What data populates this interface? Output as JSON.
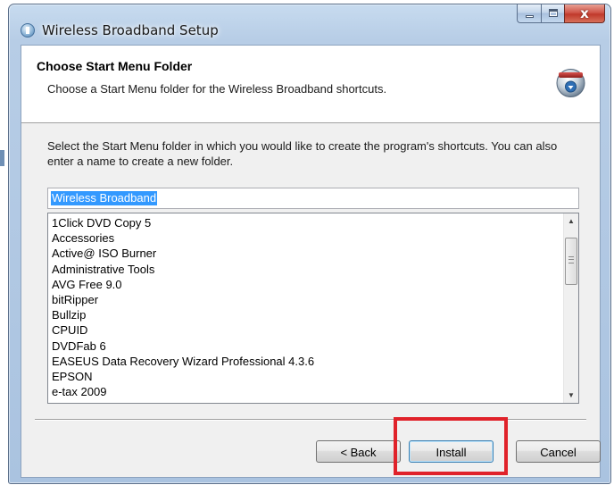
{
  "window": {
    "title": "Wireless Broadband Setup",
    "close_glyph": "x"
  },
  "header": {
    "title": "Choose Start Menu Folder",
    "subtitle": "Choose a Start Menu folder for the Wireless Broadband shortcuts."
  },
  "instructions": "Select the Start Menu folder in which you would like to create the program's shortcuts. You can also enter a name to create a new folder.",
  "folder_input": {
    "value": "Wireless Broadband",
    "selected": true
  },
  "folder_list": {
    "items": [
      "1Click DVD Copy 5",
      "Accessories",
      "Active@ ISO Burner",
      "Administrative Tools",
      "AVG Free 9.0",
      "bitRipper",
      "Bullzip",
      "CPUID",
      "DVDFab 6",
      "EASEUS Data Recovery Wizard Professional 4.3.6",
      "EPSON",
      "e-tax 2009"
    ]
  },
  "buttons": {
    "back": "< Back",
    "install": "Install",
    "cancel": "Cancel"
  },
  "colors": {
    "highlight": "#e0222a",
    "selection": "#3399ff"
  },
  "icons": {
    "app": "installer-globe-icon",
    "header": "install-disc-icon"
  }
}
